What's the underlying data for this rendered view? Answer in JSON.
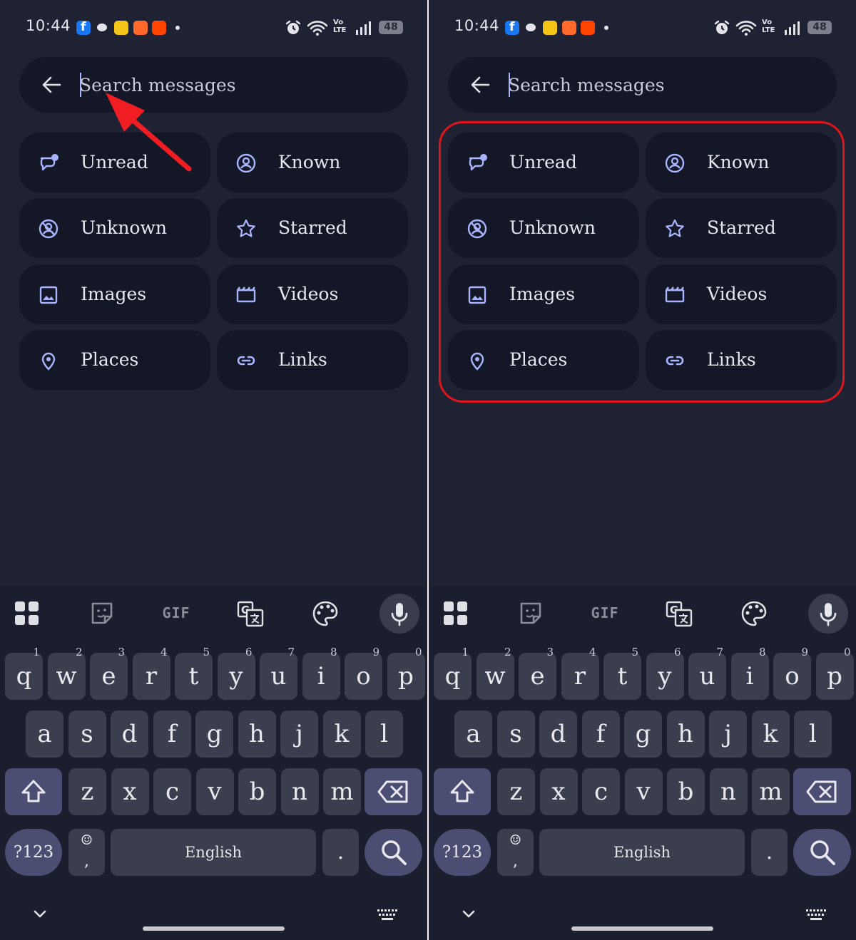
{
  "status_bar": {
    "time": "10:44",
    "volte": "Vo\nLTE",
    "battery": "48",
    "notification_icons": [
      "facebook-icon",
      "chat-bubble-icon",
      "yellow-app-icon",
      "orange-app-icon",
      "reddit-icon",
      "more-dot-icon"
    ],
    "system_icons": [
      "alarm-icon",
      "wifi-icon",
      "volte-icon",
      "signal-icon",
      "battery-icon"
    ]
  },
  "search": {
    "placeholder": "Search messages",
    "back_icon": "arrow-left-icon"
  },
  "filters": [
    {
      "label": "Unread",
      "icon": "chat-unread-icon"
    },
    {
      "label": "Known",
      "icon": "contact-circle-icon"
    },
    {
      "label": "Unknown",
      "icon": "unknown-contact-icon"
    },
    {
      "label": "Starred",
      "icon": "star-icon"
    },
    {
      "label": "Images",
      "icon": "image-icon"
    },
    {
      "label": "Videos",
      "icon": "video-clapper-icon"
    },
    {
      "label": "Places",
      "icon": "location-pin-icon"
    },
    {
      "label": "Links",
      "icon": "link-icon"
    }
  ],
  "keyboard": {
    "toolbar": [
      "apps-grid-icon",
      "sticker-icon",
      "gif-icon",
      "translate-icon",
      "palette-icon",
      "mic-icon"
    ],
    "gif_label": "GIF",
    "row1": [
      {
        "k": "q",
        "n": "1"
      },
      {
        "k": "w",
        "n": "2"
      },
      {
        "k": "e",
        "n": "3"
      },
      {
        "k": "r",
        "n": "4"
      },
      {
        "k": "t",
        "n": "5"
      },
      {
        "k": "y",
        "n": "6"
      },
      {
        "k": "u",
        "n": "7"
      },
      {
        "k": "i",
        "n": "8"
      },
      {
        "k": "o",
        "n": "9"
      },
      {
        "k": "p",
        "n": "0"
      }
    ],
    "row2": [
      "a",
      "s",
      "d",
      "f",
      "g",
      "h",
      "j",
      "k",
      "l"
    ],
    "row3": [
      "z",
      "x",
      "c",
      "v",
      "b",
      "n",
      "m"
    ],
    "numbers_key": "?123",
    "emoji_key_top": "☺",
    "emoji_key_bottom": ",",
    "space_label": "English",
    "period_key": ".",
    "shift_icon": "shift-icon",
    "backspace_icon": "backspace-icon",
    "search_key_icon": "search-icon",
    "collapse_icon": "chevron-down-icon",
    "keyboard_switch_icon": "keyboard-icon"
  },
  "colors": {
    "background": "#1f2233",
    "chip": "#141725",
    "accent": "#a9b3ff",
    "highlight": "#e0151c",
    "arrow": "#f01e22"
  }
}
